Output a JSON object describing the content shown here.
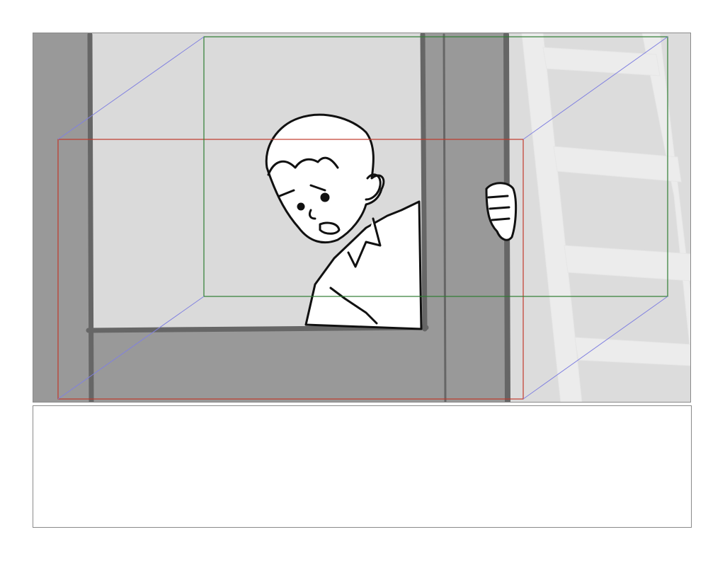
{
  "storyboard": {
    "panel_notes": "",
    "colors": {
      "wall": "#999999",
      "window_interior": "#dadada",
      "ladder": "#ececec",
      "outline": "#666666",
      "start_frame": "#c0392b",
      "end_frame": "#2e7d32",
      "camera_path": "#8080e0"
    },
    "icons": [
      "character-boy",
      "hand-grip",
      "ladder",
      "window-frame"
    ]
  }
}
